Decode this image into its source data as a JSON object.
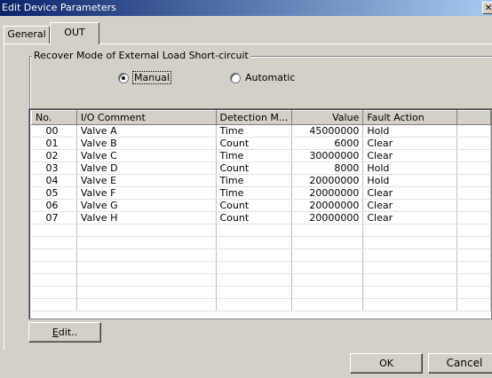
{
  "window": {
    "title": "Edit Device Parameters",
    "close_glyph": "✕"
  },
  "tabs": [
    {
      "label": "General",
      "active": false
    },
    {
      "label": "OUT",
      "active": true
    }
  ],
  "recover_mode": {
    "legend": "Recover Mode of External Load Short-circuit",
    "options": [
      {
        "label": "Manual",
        "checked": true
      },
      {
        "label": "Automatic",
        "checked": false
      }
    ]
  },
  "table": {
    "columns": [
      "No.",
      "I/O Comment",
      "Detection M...",
      "Value",
      "Fault Action",
      ""
    ],
    "rows": [
      [
        "00",
        "Valve A",
        "Time",
        "45000000",
        "Hold"
      ],
      [
        "01",
        "Valve B",
        "Count",
        "6000",
        "Clear"
      ],
      [
        "02",
        "Valve C",
        "Time",
        "30000000",
        "Clear"
      ],
      [
        "03",
        "Valve D",
        "Count",
        "8000",
        "Hold"
      ],
      [
        "04",
        "Valve E",
        "Time",
        "20000000",
        "Hold"
      ],
      [
        "05",
        "Valve F",
        "Time",
        "20000000",
        "Clear"
      ],
      [
        "06",
        "Valve G",
        "Count",
        "20000000",
        "Clear"
      ],
      [
        "07",
        "Valve H",
        "Count",
        "20000000",
        "Clear"
      ]
    ],
    "empty_rows": 7
  },
  "buttons": {
    "edit": {
      "mnemonic": "E",
      "rest": "dit.."
    },
    "ok": "OK",
    "cancel": "Cancel"
  }
}
